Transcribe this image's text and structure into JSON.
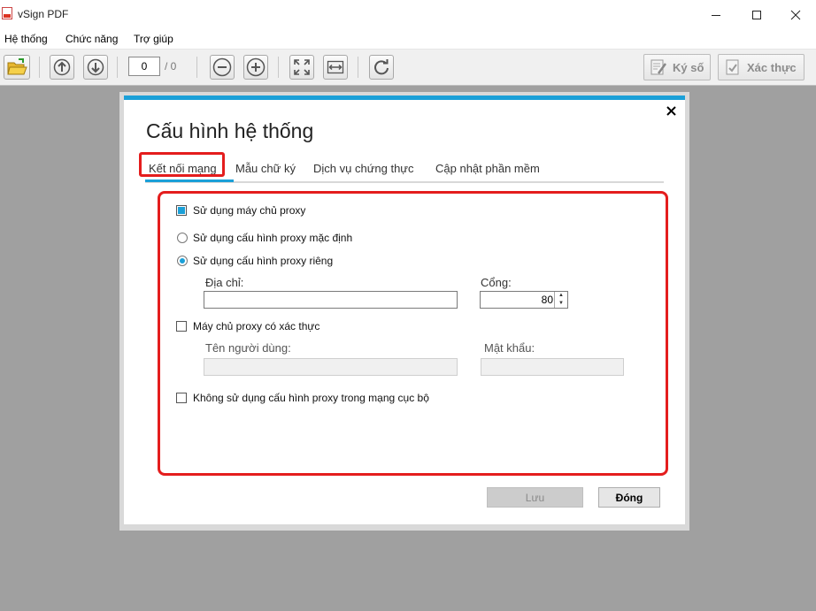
{
  "window": {
    "title": "vSign PDF"
  },
  "menu": [
    "Hệ thống",
    "Chức năng",
    "Trợ giúp"
  ],
  "toolbar": {
    "page_current": "0",
    "page_total": "/ 0",
    "sign_label": "Ký số",
    "verify_label": "Xác thực",
    "icons": [
      "open-folder-icon",
      "arrow-up-icon",
      "arrow-down-icon",
      "zoom-out-icon",
      "zoom-in-icon",
      "fit-page-icon",
      "fit-width-icon",
      "rotate-icon"
    ]
  },
  "dialog": {
    "title": "Cấu hình hệ thống",
    "tabs": [
      "Kết nối mạng",
      "Mẫu chữ ký",
      "Dịch vụ chứng thực",
      "Cập nhật phần mềm"
    ],
    "active_tab": 0,
    "use_proxy_label": "Sử dụng máy chủ proxy",
    "use_proxy_checked": true,
    "default_proxy_label": "Sử dụng cấu hình proxy mặc định",
    "custom_proxy_label": "Sử dụng cấu hình proxy riêng",
    "custom_proxy_selected": true,
    "address_label": "Địa chỉ:",
    "address_value": "",
    "port_label": "Cổng:",
    "port_value": "80",
    "auth_label": "Máy chủ proxy có xác thực",
    "auth_checked": false,
    "username_label": "Tên người dùng:",
    "password_label": "Mật khẩu:",
    "bypass_local_label": "Không sử dụng cấu hình proxy trong mạng cục bộ",
    "bypass_local_checked": false,
    "save_label": "Lưu",
    "close_label": "Đóng"
  },
  "colors": {
    "accent": "#1ba0d8",
    "highlight": "#e41d1d",
    "background": "#a0a0a0"
  }
}
